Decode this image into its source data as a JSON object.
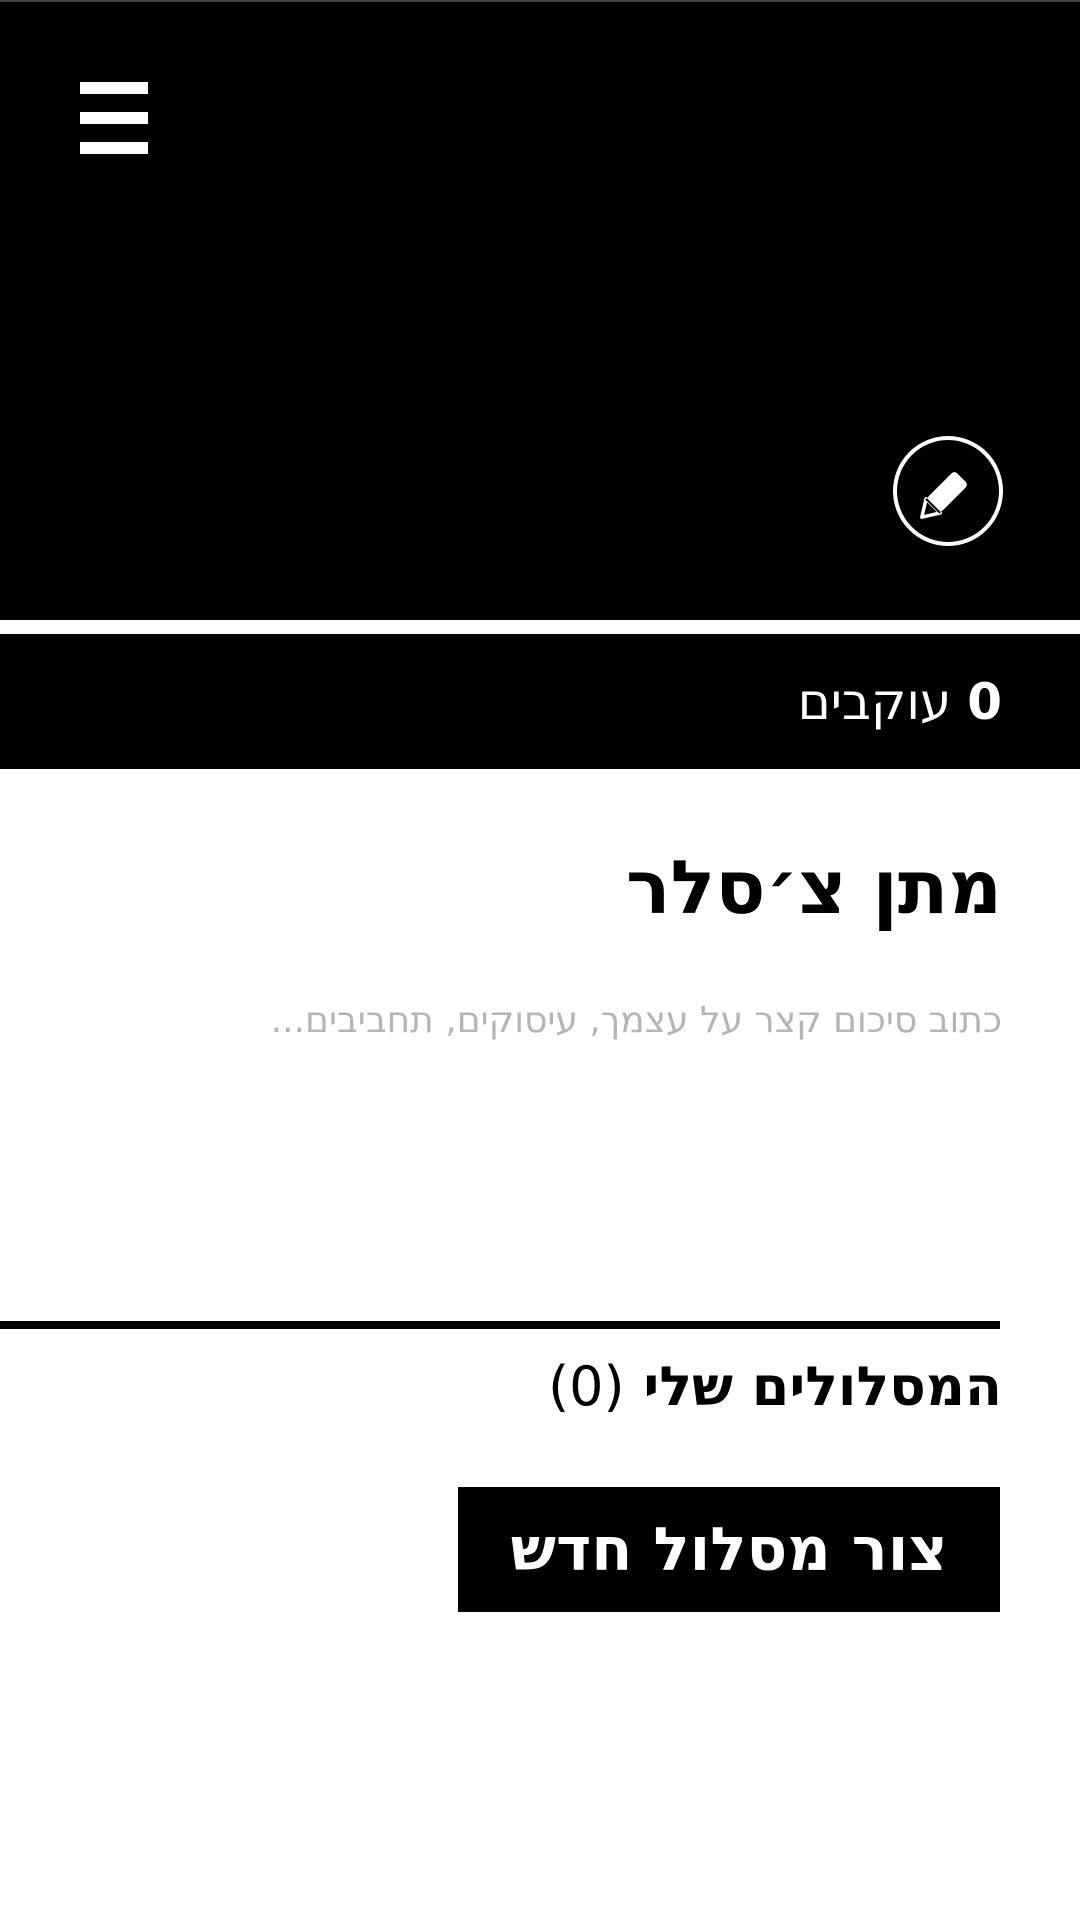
{
  "header": {
    "menu_icon": "hamburger-menu-icon",
    "edit_icon": "pencil-icon"
  },
  "followers": {
    "count": "0",
    "label": "עוקבים"
  },
  "profile": {
    "name": "מתן צ׳סלר",
    "bio_value": "",
    "bio_placeholder": "כתוב סיכום קצר על עצמך, עיסוקים, תחביבים..."
  },
  "routes": {
    "title": "המסלולים שלי",
    "count": "(0)",
    "create_button_label": "צור מסלול חדש"
  },
  "colors": {
    "primary": "#000000",
    "background": "#ffffff",
    "placeholder": "#b5b5b5"
  }
}
